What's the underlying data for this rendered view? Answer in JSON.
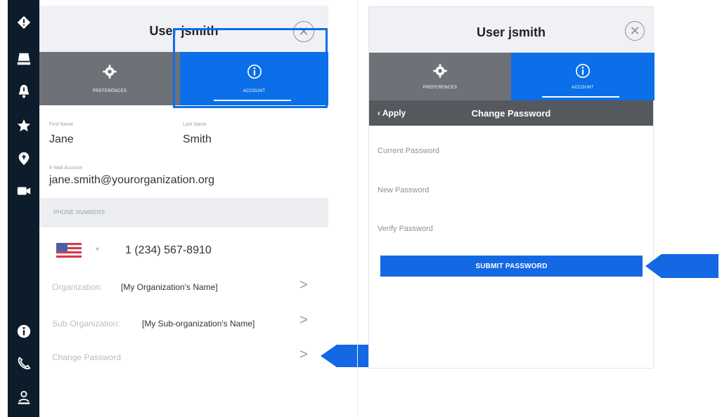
{
  "colors": {
    "rail": "#0d1c2b",
    "tab_inactive": "#6e7177",
    "tab_active": "#0a6fe8",
    "accent": "#1468e4",
    "subbar": "#55595e"
  },
  "rail": {
    "icons": [
      "diamond-nav-icon",
      "monitor-icon",
      "bell-icon",
      "star-icon",
      "location-pin-icon",
      "video-camera-icon",
      "info-icon",
      "phone-icon",
      "person-badge-icon"
    ]
  },
  "left_panel": {
    "title": "User jsmith",
    "close_symbol": "✕",
    "tabs": [
      {
        "label": "Preferences",
        "icon": "gear-icon"
      },
      {
        "label": "Account",
        "icon": "info-circle-icon"
      }
    ],
    "first_name_label": "First Name",
    "first_name": "Jane",
    "last_name_label": "Last Name",
    "last_name": "Smith",
    "email_label": "E-Mail Account",
    "email": "jane.smith@yourorganization.org",
    "phone_section_label": "PHONE NUMBERS",
    "phone_country_symbol": "▾",
    "phone_number": "1 (234) 567-8910",
    "organization_label": "Organization:",
    "organization_value": "[My Organization's Name]",
    "sub_organization_label": "Sub-Organization:",
    "sub_organization_value": "[My Sub-organization's Name]",
    "change_password_label": "Change Password",
    "chevron": ">"
  },
  "right_panel": {
    "title": "User jsmith",
    "close_symbol": "✕",
    "tabs": [
      {
        "label": "Preferences",
        "icon": "gear-icon"
      },
      {
        "label": "Account",
        "icon": "info-circle-icon"
      }
    ],
    "back_label": "‹  Apply",
    "subheader_title": "Change Password",
    "current_password_label": "Current Password",
    "new_password_label": "New Password",
    "verify_password_label": "Verify Password",
    "submit_label": "SUBMIT PASSWORD"
  }
}
